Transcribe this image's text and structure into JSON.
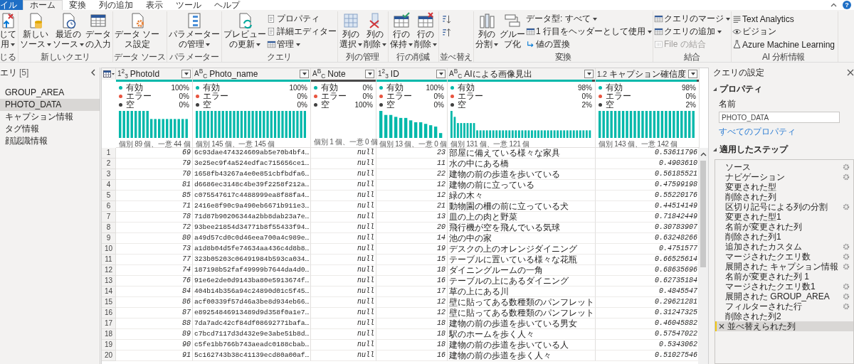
{
  "ribbon": {
    "tabs": [
      {
        "label": "イル",
        "kind": "file",
        "selected": false
      },
      {
        "label": "ホーム",
        "kind": "tab",
        "selected": true
      },
      {
        "label": "変換",
        "kind": "tab",
        "selected": false
      },
      {
        "label": "列の追加",
        "kind": "tab",
        "selected": false
      },
      {
        "label": "表示",
        "kind": "tab",
        "selected": false
      },
      {
        "label": "ツール",
        "kind": "tab",
        "selected": false
      },
      {
        "label": "ヘルプ",
        "kind": "tab",
        "selected": false
      }
    ],
    "help": "?",
    "groups": [
      {
        "label": "じる",
        "items": [
          {
            "kind": "large",
            "lines": [
              "じて",
              "用"
            ],
            "dropdown": true
          }
        ]
      },
      {
        "label": "新しいクエリ",
        "items": [
          {
            "kind": "large",
            "lines": [
              "新しい",
              "ソース"
            ],
            "dropdown": true
          },
          {
            "kind": "large",
            "lines": [
              "最近の",
              "ソース"
            ],
            "dropdown": true
          },
          {
            "kind": "large",
            "lines": [
              "データ",
              "の入力"
            ],
            "dropdown": false
          }
        ]
      },
      {
        "label": "データ ソース",
        "items": [
          {
            "kind": "large",
            "lines": [
              "データ ソー",
              "ス設定"
            ],
            "dropdown": false
          }
        ]
      },
      {
        "label": "パラメーター",
        "items": [
          {
            "kind": "large",
            "lines": [
              "パラメーター",
              "の管理"
            ],
            "dropdown": true
          }
        ]
      },
      {
        "label": "クエリ",
        "items": [
          {
            "kind": "large",
            "lines": [
              "プレビュー",
              "の更新"
            ],
            "dropdown": true
          },
          {
            "kind": "small",
            "label": "プロパティ",
            "dropdown": false
          },
          {
            "kind": "small",
            "label": "詳細エディター",
            "dropdown": false
          },
          {
            "kind": "small",
            "label": "管理",
            "dropdown": true
          }
        ]
      },
      {
        "label": "列の管理",
        "items": [
          {
            "kind": "large",
            "lines": [
              "列の",
              "選択"
            ],
            "dropdown": true
          },
          {
            "kind": "large",
            "lines": [
              "列の",
              "削除"
            ],
            "dropdown": true
          }
        ]
      },
      {
        "label": "行の削減",
        "items": [
          {
            "kind": "large",
            "lines": [
              "行の",
              "保持"
            ],
            "dropdown": true
          },
          {
            "kind": "large",
            "lines": [
              "行の",
              "削除"
            ],
            "dropdown": true
          }
        ]
      },
      {
        "label": "並べ替え",
        "items": [
          {
            "kind": "icon"
          },
          {
            "kind": "icon"
          }
        ]
      },
      {
        "label": "変換",
        "items": [
          {
            "kind": "large",
            "lines": [
              "列の",
              "分割"
            ],
            "dropdown": true
          },
          {
            "kind": "large",
            "lines": [
              "グルー",
              "プ化"
            ],
            "dropdown": false
          },
          {
            "kind": "small",
            "label": "データ型: すべて",
            "dropdown": true
          },
          {
            "kind": "small",
            "label": "1 行目をヘッダーとして使用",
            "dropdown": true
          },
          {
            "kind": "small",
            "label": "値の置換",
            "dropdown": false
          }
        ]
      },
      {
        "label": "結合",
        "items": [
          {
            "kind": "small",
            "label": "クエリのマージ",
            "dropdown": true,
            "disabled": false
          },
          {
            "kind": "small",
            "label": "クエリの追加",
            "dropdown": true,
            "disabled": false
          },
          {
            "kind": "small",
            "label": "File の結合",
            "dropdown": false,
            "disabled": true
          }
        ]
      },
      {
        "label": "AI 分析情報",
        "items": [
          {
            "kind": "small",
            "label": "Text Analytics",
            "dropdown": false
          },
          {
            "kind": "small",
            "label": "ビジョン",
            "dropdown": false
          },
          {
            "kind": "small",
            "label": "Azure Machine Learning",
            "dropdown": false
          }
        ]
      }
    ]
  },
  "queries": {
    "title": "エリ",
    "count": "[5]",
    "items": [
      {
        "label": "GROUP_AREA",
        "selected": false
      },
      {
        "label": "PHOTO_DATA",
        "selected": true
      },
      {
        "label": "キャプション情報",
        "selected": false
      },
      {
        "label": "タグ情報",
        "selected": false
      },
      {
        "label": "顔認識情報",
        "selected": false
      }
    ]
  },
  "grid": {
    "columns": [
      {
        "type_label": "1$^{2}$$_{3}$",
        "name": "PhotoId",
        "kind": "number",
        "level": 1,
        "stats": [
          {
            "label": "有効",
            "value": "100%",
            "color": "#01b8aa"
          },
          {
            "label": "エラー",
            "value": "0%",
            "color": "#e8543f"
          },
          {
            "label": "空",
            "value": "0%",
            "color": "#404040"
          }
        ],
        "distinct": "個別 89 個、一意 44 個"
      },
      {
        "type_label": "A$^{B}$$_{C}$",
        "name": "Photo_name",
        "kind": "hash",
        "level": 1,
        "stats": [
          {
            "label": "有効",
            "value": "100%",
            "color": "#01b8aa"
          },
          {
            "label": "エラー",
            "value": "0%",
            "color": "#e8543f"
          },
          {
            "label": "空",
            "value": "0%",
            "color": "#404040"
          }
        ],
        "distinct": "個別 145 個、一意 145 個"
      },
      {
        "type_label": "A$^{B}$$_{C}$",
        "name": "Note",
        "kind": "null",
        "level": 0,
        "stats": [
          {
            "label": "有効",
            "value": "0%",
            "color": "#01b8aa"
          },
          {
            "label": "エラー",
            "value": "0%",
            "color": "#e8543f"
          },
          {
            "label": "空",
            "value": "100%",
            "color": "#404040"
          }
        ],
        "distinct": "個別 1 個、一意 0 個"
      },
      {
        "type_label": "1$^{2}$$_{3}$",
        "name": "ID",
        "kind": "number",
        "level": 1,
        "stats": [
          {
            "label": "有効",
            "value": "100%",
            "color": "#01b8aa"
          },
          {
            "label": "エラー",
            "value": "0%",
            "color": "#e8543f"
          },
          {
            "label": "空",
            "value": "0%",
            "color": "#404040"
          }
        ],
        "distinct": "個別 13 個、一意 0 個"
      },
      {
        "type_label": "A$^{B}$$_{C}$",
        "name": "AIによる画像見出",
        "kind": "text",
        "level": 0.98,
        "stats": [
          {
            "label": "有効",
            "value": "98%",
            "color": "#01b8aa"
          },
          {
            "label": "エラー",
            "value": "0%",
            "color": "#e8543f"
          },
          {
            "label": "空",
            "value": "2%",
            "color": "#404040"
          }
        ],
        "distinct": "個別 131 個、一意 121 個"
      },
      {
        "type_label": "1.2",
        "name": "キャプション確信度",
        "kind": "number",
        "level": 0.98,
        "stats": [
          {
            "label": "有効",
            "value": "98%",
            "color": "#01b8aa"
          },
          {
            "label": "エラー",
            "value": "0%",
            "color": "#e8543f"
          },
          {
            "label": "空",
            "value": "2%",
            "color": "#404040"
          }
        ],
        "distinct": "個別 143 個、一意 142 個"
      }
    ],
    "rows": [
      {
        "number": "1",
        "cells": [
          "69",
          "6c93dae474324609ab5e70b4bf4…",
          "null",
          "23",
          "部屋に備えている様々な家具",
          "0.53611796"
        ]
      },
      {
        "number": "2",
        "cells": [
          "79",
          "3e25ec9f4a524edfac715656ce1…",
          "null",
          "11",
          "水の中にある橋",
          "0.4903610"
        ]
      },
      {
        "number": "3",
        "cells": [
          "70",
          "1658fb43267a4e0e851cbfbdfa6…",
          "null",
          "22",
          "建物の前の歩道を歩いている",
          "0.56185521"
        ]
      },
      {
        "number": "4",
        "cells": [
          "81",
          "d6686ec3148c4be39f2258f212a…",
          "null",
          "12",
          "建物の前に立っている",
          "0.47599198"
        ]
      },
      {
        "number": "5",
        "cells": [
          "85",
          "c075547617c4488999ea8f88fa4…",
          "null",
          "12",
          "緑の木々",
          "0.55220176"
        ]
      },
      {
        "number": "6",
        "cells": [
          "71",
          "2416e8f90c9a490eb6671b911e3…",
          "null",
          "21",
          "動物園の柵の前に立っている犬",
          "0.44514149"
        ]
      },
      {
        "number": "7",
        "cells": [
          "78",
          "71d87b90206344a2bb8dab23a7e…",
          "null",
          "13",
          "皿の上の肉と野菜",
          "0.71842449"
        ]
      },
      {
        "number": "8",
        "cells": [
          "72",
          "93bee21854d34771b8f55433f94…",
          "null",
          "20",
          "飛行機が空を飛んでいる気球",
          "0.30783907"
        ]
      },
      {
        "number": "9",
        "cells": [
          "80",
          "a49d57cd0c0d46eea700a4c989e…",
          "null",
          "14",
          "池の中の家",
          "0.63248266"
        ]
      },
      {
        "number": "10",
        "cells": [
          "73",
          "a1d8b04d5fe74634aa436c4d8b8…",
          "null",
          "19",
          "デスクの上のオレンジダイニング",
          "0.4751577"
        ]
      },
      {
        "number": "11",
        "cells": [
          "77",
          "323b05203c06491984b593ca034…",
          "null",
          "15",
          "テーブルに置いている様々な花瓶",
          "0.66525614"
        ]
      },
      {
        "number": "12",
        "cells": [
          "74",
          "187198b52faf49999b7644da4d0…",
          "null",
          "18",
          "ダイニングルームの一角",
          "0.68635696"
        ]
      },
      {
        "number": "13",
        "cells": [
          "76",
          "91e6e2de0d9143ba80e5913674f…",
          "null",
          "16",
          "テーブルの上にあるダイニング",
          "0.62735184"
        ]
      },
      {
        "number": "14",
        "cells": [
          "84",
          "404b14b356a94c24890d01c5f45…",
          "null",
          "17",
          "草の上にある川",
          "0.4845547"
        ]
      },
      {
        "number": "15",
        "cells": [
          "86",
          "acf00339f57d46a3be8d934eb66…",
          "null",
          "12",
          "壁に貼ってある数種類のパンフレット",
          "0.29621281"
        ]
      },
      {
        "number": "16",
        "cells": [
          "87",
          "e89254846913489d9d358f0a1e7…",
          "null",
          "12",
          "壁に貼ってある数種類のパンフレット",
          "0.31247325"
        ]
      },
      {
        "number": "17",
        "cells": [
          "88",
          "7da7adc42cf84df08692771bafa…",
          "null",
          "18",
          "建物の前の歩道を歩いている男女",
          "0.46045882"
        ]
      },
      {
        "number": "18",
        "cells": [
          "89",
          "c7bcd7117d3d432e9e3abe51b8d…",
          "null",
          "18",
          "駅のホームを歩く人々",
          "0.57547022"
        ]
      },
      {
        "number": "19",
        "cells": [
          "90",
          "c5fe1bb766b743aeadc0188cbab…",
          "null",
          "18",
          "建物の前の歩道を歩いている人",
          "0.5343062"
        ]
      },
      {
        "number": "20",
        "cells": [
          "91",
          "5c162743b38c41139ecd80a00af…",
          "null",
          "16",
          "建物の前の歩道を歩く人々",
          "0.51027546"
        ]
      }
    ]
  },
  "settings": {
    "title": "クエリの設定",
    "properties_heading": "プロパティ",
    "name_label": "名前",
    "name_value": "PHOTO_DATA",
    "all_properties_link": "すべてのプロパティ",
    "steps_heading": "適用したステップ",
    "steps": [
      {
        "label": "ソース",
        "settings": true,
        "selected": false
      },
      {
        "label": "ナビゲーション",
        "settings": true,
        "selected": false
      },
      {
        "label": "変更された型",
        "settings": false,
        "selected": false
      },
      {
        "label": "削除された列",
        "settings": false,
        "selected": false
      },
      {
        "label": "区切り記号による列の分割",
        "settings": true,
        "selected": false
      },
      {
        "label": "変更された型1",
        "settings": false,
        "selected": false
      },
      {
        "label": "名前が変更された列",
        "settings": false,
        "selected": false
      },
      {
        "label": "削除された列1",
        "settings": false,
        "selected": false
      },
      {
        "label": "追加されたカスタム",
        "settings": true,
        "selected": false
      },
      {
        "label": "マージされたクエリ数",
        "settings": true,
        "selected": false
      },
      {
        "label": "展開された キャプション情報",
        "settings": true,
        "selected": false
      },
      {
        "label": "名前が変更された列 1",
        "settings": false,
        "selected": false
      },
      {
        "label": "マージされたクエリ数1",
        "settings": true,
        "selected": false
      },
      {
        "label": "展開された GROUP_AREA",
        "settings": true,
        "selected": false
      },
      {
        "label": "フィルターされた行",
        "settings": true,
        "selected": false
      },
      {
        "label": "削除された列2",
        "settings": false,
        "selected": false
      },
      {
        "label": "並べ替えられた列",
        "settings": false,
        "selected": true
      }
    ]
  }
}
